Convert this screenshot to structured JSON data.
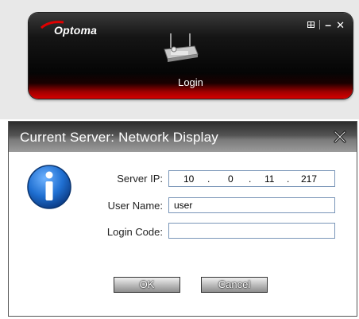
{
  "app": {
    "logo_text": "Optoma",
    "panel_title": "Login",
    "icons": {
      "controls": [
        "grid-icon",
        "minimize-icon",
        "close-icon"
      ],
      "device": "network-device-icon"
    }
  },
  "dialog": {
    "title": "Current Server: Network Display",
    "close_icon": "close-x-icon",
    "info_icon": "info-icon",
    "fields": {
      "server_ip_label": "Server IP:",
      "server_ip": [
        "10",
        "0",
        "11",
        "217"
      ],
      "username_label": "User Name:",
      "username_value": "user",
      "login_code_label": "Login Code:",
      "login_code_value": ""
    },
    "buttons": {
      "ok": "OK",
      "cancel": "Cancel"
    }
  },
  "colors": {
    "panel_red": "#d50000",
    "panel_black": "#050505",
    "input_border": "#7a96b8",
    "info_blue": "#1f6fd1"
  }
}
